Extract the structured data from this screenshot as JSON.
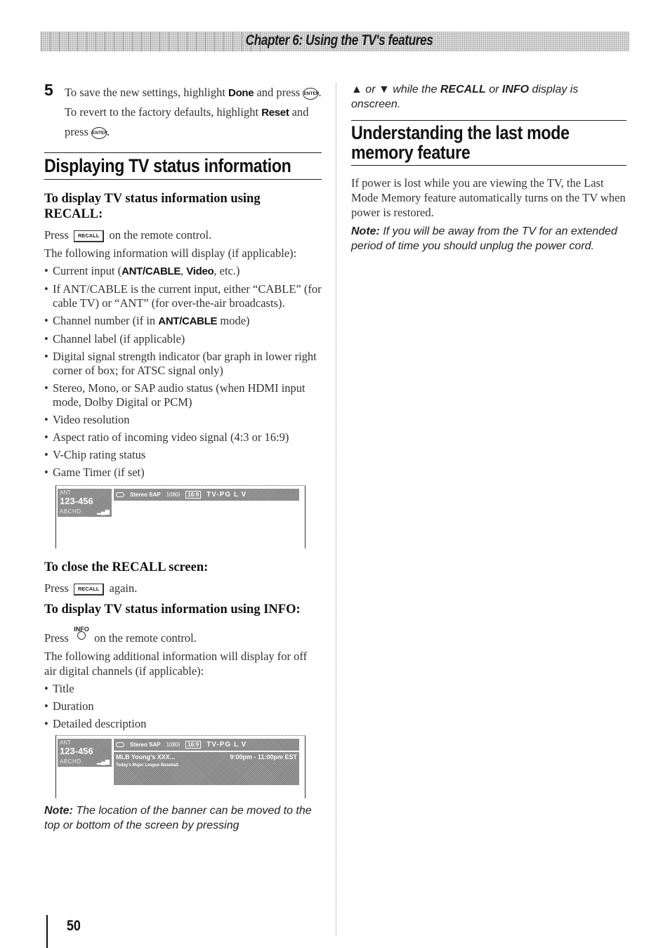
{
  "header": {
    "chapter_title": "Chapter 6: Using the TV's features"
  },
  "left": {
    "step5": {
      "number": "5",
      "text_1": "To save the new settings, highlight ",
      "done_label": "Done",
      "text_2": " and press ",
      "enter_icon": "ENTER",
      "text_3": ". To revert to the factory defaults, highlight ",
      "reset_label": "Reset",
      "text_4": " and press ",
      "text_5": "."
    },
    "section_heading": "Displaying TV status information",
    "recall_heading": "To display TV status information using RECALL:",
    "recall_press_1": "Press ",
    "recall_key": "RECALL",
    "recall_press_2": " on the remote control.",
    "recall_intro": "The following information will display (if applicable):",
    "bullet_current_input": {
      "prefix": "Current input (",
      "b1": "ANT/CABLE",
      "sep": ", ",
      "b2": "Video",
      "suffix": ", etc.)"
    },
    "bullet_ant_cable": "If ANT/CABLE is the current input, either “CABLE” (for cable TV) or “ANT” (for over-the-air broadcasts).",
    "bullet_channel_number": {
      "prefix": "Channel number (if in ",
      "bold": "ANT/CABLE",
      "suffix": " mode)"
    },
    "bullets_rest": [
      "Channel label (if applicable)",
      "Digital signal strength indicator (bar graph in lower right corner of box; for ATSC signal only)",
      "Stereo, Mono, or SAP audio status (when HDMI input mode, Dolby Digital or PCM)",
      "Video resolution",
      "Aspect ratio of incoming video signal (4:3 or 16:9)",
      "V-Chip rating status",
      "Game Timer (if set)"
    ],
    "close_heading": "To close the RECALL screen:",
    "close_press_1": "Press ",
    "close_press_2": " again.",
    "info_heading": "To display TV status information using INFO:",
    "info_press_1": "Press ",
    "info_key": "INFO",
    "info_press_2": " on the remote control.",
    "info_intro": "The following additional information will display for off air digital channels (if applicable):",
    "info_bullets": [
      "Title",
      "Duration",
      "Detailed description"
    ],
    "note_label": "Note:",
    "note_text": " The location of the banner can be moved to the top or bottom of the screen by pressing"
  },
  "tv_banner": {
    "source": "ANT",
    "channel_number": "123-456",
    "channel_label": "ABCHD",
    "signal_icon": "signal-strength",
    "audio": "Stereo SAP",
    "resolution": "1080i",
    "aspect": "16:9",
    "rating": "TV-PG  L  V"
  },
  "tv_info_banner": {
    "program_title": "MLB Young's XXX...",
    "program_time": "9:00pm - 11:00pm EST",
    "program_description": "Today's Major League Baseball."
  },
  "right": {
    "note_cont_up": "▲",
    "note_cont_or": " or ",
    "note_cont_down": "▼",
    "note_cont_1": " while the ",
    "note_cont_recall": "RECALL",
    "note_cont_2": " or ",
    "note_cont_info": "INFO",
    "note_cont_3": " display is onscreen.",
    "section_heading": "Understanding the last mode memory feature",
    "body": "If power is lost while you are viewing the TV, the Last Mode Memory feature automatically turns on the TV when power is restored.",
    "note_label": "Note:",
    "note_text": " If you will be away from the TV for an extended period of time you should unplug the power cord."
  },
  "footer": {
    "page_number": "50"
  }
}
